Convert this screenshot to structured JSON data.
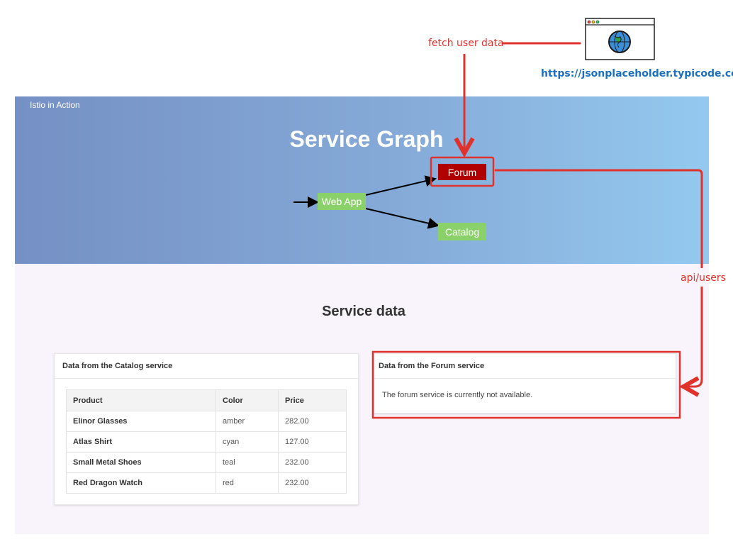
{
  "annotations": {
    "fetch_label": "fetch user data",
    "source_url": "https://jsonplaceholder.typicode.com/",
    "api_label": "api/users",
    "accent_color": "#e0322d"
  },
  "header": {
    "brand": "Istio in Action",
    "title": "Service Graph"
  },
  "graph": {
    "web_app": "Web App",
    "forum": "Forum",
    "catalog": "Catalog",
    "node_color": "#8bd16a",
    "forum_color": "#b00000"
  },
  "service_data": {
    "title": "Service data"
  },
  "catalog_card": {
    "header": "Data from the Catalog service",
    "columns": [
      "Product",
      "Color",
      "Price"
    ],
    "rows": [
      [
        "Elinor Glasses",
        "amber",
        "282.00"
      ],
      [
        "Atlas Shirt",
        "cyan",
        "127.00"
      ],
      [
        "Small Metal Shoes",
        "teal",
        "232.00"
      ],
      [
        "Red Dragon Watch",
        "red",
        "232.00"
      ]
    ]
  },
  "forum_card": {
    "header": "Data from the Forum service",
    "message": "The forum service is currently not available."
  },
  "icons": {
    "browser": "browser-globe-icon"
  }
}
